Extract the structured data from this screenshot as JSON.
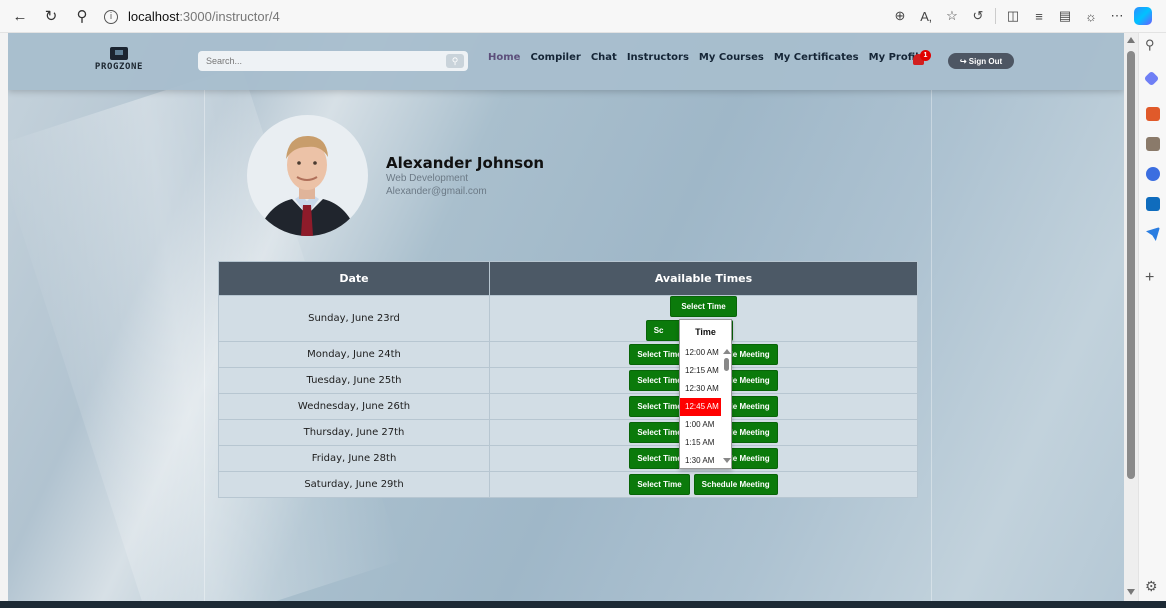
{
  "browser": {
    "url_host": "localhost",
    "url_path": ":3000/instructor/4"
  },
  "site": {
    "logo_text": "PROGZONE",
    "search_placeholder": "Search...",
    "nav": [
      "Home",
      "Compiler",
      "Chat",
      "Instructors",
      "My Courses",
      "My Certificates",
      "My Profile"
    ],
    "notification_count": "1",
    "sign_out_label": "Sign Out",
    "sign_out_icon": "sign-out-icon",
    "accent_color": "#5d4f7b"
  },
  "profile": {
    "name": "Alexander Johnson",
    "specialty": "Web Development",
    "email": "Alexander@gmail.com"
  },
  "schedule": {
    "headers": [
      "Date",
      "Available Times"
    ],
    "select_label": "Select Time",
    "schedule_label": "Schedule Meeting",
    "schedule_partial_label": "Sc",
    "schedule_partial_suffix": "ng",
    "schedule_cut_label": "le Meeting",
    "rows": [
      {
        "date": "Sunday, June 23rd"
      },
      {
        "date": "Monday, June 24th"
      },
      {
        "date": "Tuesday, June 25th"
      },
      {
        "date": "Wednesday, June 26th"
      },
      {
        "date": "Thursday, June 27th"
      },
      {
        "date": "Friday, June 28th"
      },
      {
        "date": "Saturday, June 29th"
      }
    ],
    "button_color": "#0b7a0b"
  },
  "time_dropdown": {
    "header": "Time",
    "options": [
      "12:00 AM",
      "12:15 AM",
      "12:30 AM",
      "12:45 AM",
      "1:00 AM",
      "1:15 AM",
      "1:30 AM"
    ],
    "selected": "12:45 AM",
    "selected_color": "#ff0000"
  }
}
